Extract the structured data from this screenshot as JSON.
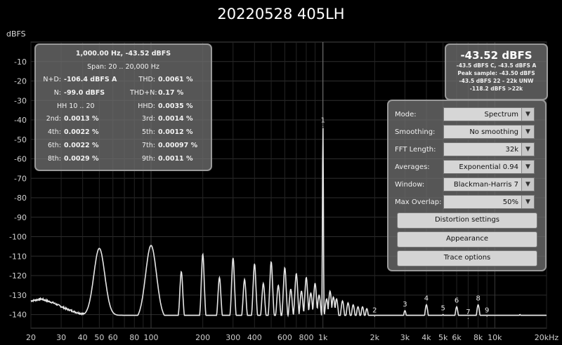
{
  "title": "20220528 405LH",
  "y_unit": "dBFS",
  "stats": {
    "header": "1,000.00 Hz, -43.52 dBFS",
    "span": "Span: 20 .. 20,000 Hz",
    "hh": "HH 10 .. 20",
    "rows": [
      {
        "l1": "N+D:",
        "v1": "-106.4 dBFS A",
        "l2": "THD:",
        "v2": "0.0061 %"
      },
      {
        "l1": "N:",
        "v1": "-99.0 dBFS",
        "l2": "THD+N:",
        "v2": "0.17 %"
      },
      {
        "l1": "",
        "v1": "",
        "l2": "HHD:",
        "v2": "0.0035 %"
      },
      {
        "l1": "2nd:",
        "v1": "0.0013 %",
        "l2": "3rd:",
        "v2": "0.0014 %"
      },
      {
        "l1": "4th:",
        "v1": "0.0022 %",
        "l2": "5th:",
        "v2": "0.0012 %"
      },
      {
        "l1": "6th:",
        "v1": "0.0022 %",
        "l2": "7th:",
        "v2": "0.00097 %"
      },
      {
        "l1": "8th:",
        "v1": "0.0029 %",
        "l2": "9th:",
        "v2": "0.0011 %"
      }
    ]
  },
  "level": {
    "big": "-43.52 dBFS",
    "lines": [
      "-43.5 dBFS C, -43.5 dBFS A",
      "Peak sample: -43.50 dBFS",
      "-43.5 dBFS 22 - 22k UNW",
      "-118.2 dBFS >22k"
    ]
  },
  "settings": {
    "rows": [
      {
        "label": "Mode:",
        "value": "Spectrum"
      },
      {
        "label": "Smoothing:",
        "value": "No  smoothing"
      },
      {
        "label": "FFT Length:",
        "value": "32k"
      },
      {
        "label": "Averages:",
        "value": "Exponential 0.94"
      },
      {
        "label": "Window:",
        "value": "Blackman-Harris 7"
      },
      {
        "label": "Max Overlap:",
        "value": "50%"
      }
    ],
    "buttons": [
      "Distortion settings",
      "Appearance",
      "Trace options"
    ]
  },
  "chart_data": {
    "type": "line",
    "y_unit": "dBFS",
    "x_scale": "log",
    "xlim": [
      20,
      20000
    ],
    "ylim": [
      -147,
      0
    ],
    "y_ticks": [
      -10,
      -20,
      -30,
      -40,
      -50,
      -60,
      -70,
      -80,
      -90,
      -100,
      -110,
      -120,
      -130,
      -140
    ],
    "x_ticks": [
      {
        "v": 20,
        "t": "20"
      },
      {
        "v": 30,
        "t": "30"
      },
      {
        "v": 40,
        "t": "40"
      },
      {
        "v": 50,
        "t": "50"
      },
      {
        "v": 60,
        "t": "60"
      },
      {
        "v": 80,
        "t": "80"
      },
      {
        "v": 100,
        "t": "100"
      },
      {
        "v": 200,
        "t": "200"
      },
      {
        "v": 300,
        "t": "300"
      },
      {
        "v": 400,
        "t": "400"
      },
      {
        "v": 600,
        "t": "600"
      },
      {
        "v": 800,
        "t": "800"
      },
      {
        "v": 1000,
        "t": "1k"
      },
      {
        "v": 2000,
        "t": "2k"
      },
      {
        "v": 3000,
        "t": "3k"
      },
      {
        "v": 4000,
        "t": "4k"
      },
      {
        "v": 5000,
        "t": "5k"
      },
      {
        "v": 6000,
        "t": "6k"
      },
      {
        "v": 8000,
        "t": "8k"
      },
      {
        "v": 10000,
        "t": "10k"
      },
      {
        "v": 20000,
        "t": "20kHz"
      }
    ],
    "harmonic_labels": [
      {
        "t": "1",
        "f": 1000,
        "y": -43.5
      },
      {
        "t": "2",
        "f": 2000,
        "y": -141
      },
      {
        "t": "3",
        "f": 3000,
        "y": -138
      },
      {
        "t": "4",
        "f": 4000,
        "y": -135
      },
      {
        "t": "5",
        "f": 5000,
        "y": -140
      },
      {
        "t": "6",
        "f": 6000,
        "y": -136
      },
      {
        "t": "7",
        "f": 7000,
        "y": -142
      },
      {
        "t": "8",
        "f": 8000,
        "y": -135
      },
      {
        "t": "9",
        "f": 9000,
        "y": -141
      }
    ],
    "peaks": [
      {
        "f": 50,
        "y": -106
      },
      {
        "f": 100,
        "y": -104.5
      },
      {
        "f": 150,
        "y": -118
      },
      {
        "f": 200,
        "y": -109
      },
      {
        "f": 250,
        "y": -121
      },
      {
        "f": 300,
        "y": -111
      },
      {
        "f": 350,
        "y": -122
      },
      {
        "f": 400,
        "y": -114
      },
      {
        "f": 450,
        "y": -124
      },
      {
        "f": 500,
        "y": -113
      },
      {
        "f": 550,
        "y": -125
      },
      {
        "f": 600,
        "y": -116
      },
      {
        "f": 650,
        "y": -127
      },
      {
        "f": 700,
        "y": -119
      },
      {
        "f": 750,
        "y": -128
      },
      {
        "f": 800,
        "y": -121
      },
      {
        "f": 850,
        "y": -129
      },
      {
        "f": 900,
        "y": -124
      },
      {
        "f": 950,
        "y": -130
      },
      {
        "f": 1000,
        "y": -43.5
      },
      {
        "f": 1050,
        "y": -132
      },
      {
        "f": 1100,
        "y": -128
      },
      {
        "f": 1150,
        "y": -131
      },
      {
        "f": 1200,
        "y": -132
      },
      {
        "f": 1300,
        "y": -133
      },
      {
        "f": 1400,
        "y": -134
      },
      {
        "f": 1500,
        "y": -135
      },
      {
        "f": 1600,
        "y": -136
      },
      {
        "f": 1700,
        "y": -136
      },
      {
        "f": 1800,
        "y": -137
      },
      {
        "f": 2000,
        "y": -141
      },
      {
        "f": 3000,
        "y": -138
      },
      {
        "f": 4000,
        "y": -135
      },
      {
        "f": 5000,
        "y": -140
      },
      {
        "f": 6000,
        "y": -136
      },
      {
        "f": 7000,
        "y": -142
      },
      {
        "f": 8000,
        "y": -135
      },
      {
        "f": 9000,
        "y": -141
      },
      {
        "f": 14000,
        "y": -140
      }
    ],
    "floor": [
      {
        "f": 20,
        "y": -133
      },
      {
        "f": 23,
        "y": -132
      },
      {
        "f": 27,
        "y": -134
      },
      {
        "f": 32,
        "y": -137
      },
      {
        "f": 37,
        "y": -139
      },
      {
        "f": 42,
        "y": -140
      },
      {
        "f": 47,
        "y": -140
      },
      {
        "f": 55,
        "y": -141
      },
      {
        "f": 60,
        "y": -143
      },
      {
        "f": 70,
        "y": -142
      },
      {
        "f": 80,
        "y": -143
      },
      {
        "f": 90,
        "y": -142
      },
      {
        "f": 120,
        "y": -143
      },
      {
        "f": 200,
        "y": -144
      },
      {
        "f": 500,
        "y": -144
      },
      {
        "f": 1000,
        "y": -144
      },
      {
        "f": 2000,
        "y": -145
      },
      {
        "f": 5000,
        "y": -145
      },
      {
        "f": 10000,
        "y": -145
      },
      {
        "f": 20000,
        "y": -145
      }
    ]
  }
}
